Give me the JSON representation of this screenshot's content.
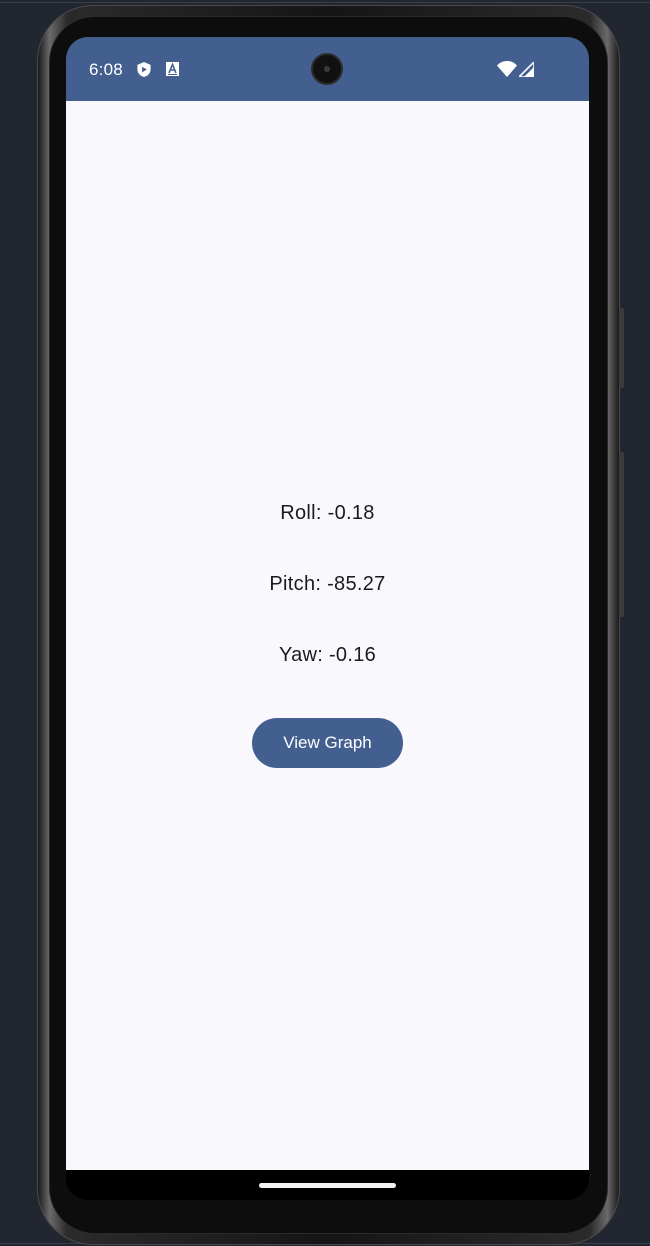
{
  "status_bar": {
    "time": "6:08",
    "icons": [
      "shield-icon",
      "a-box-icon",
      "wifi-icon",
      "signal-icon"
    ],
    "color": "#435f90"
  },
  "readings": {
    "roll": "Roll: -0.18",
    "pitch": "Pitch: -85.27",
    "yaw": "Yaw: -0.16"
  },
  "actions": {
    "view_graph_label": "View Graph",
    "button_color": "#435f90"
  }
}
